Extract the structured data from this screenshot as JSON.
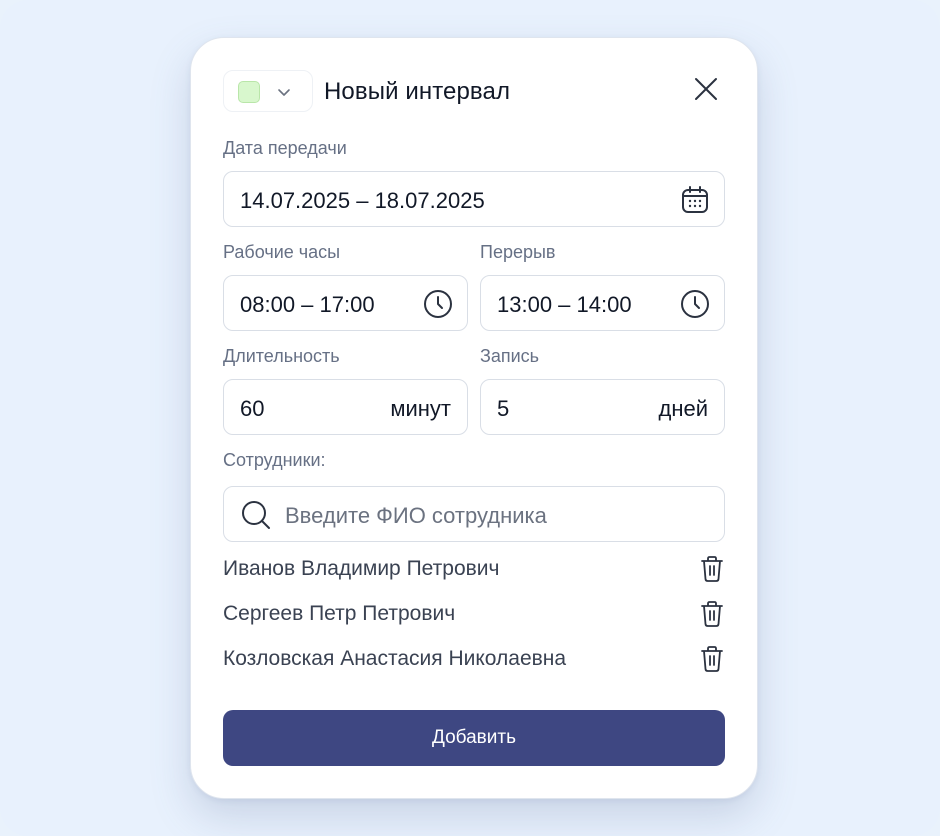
{
  "modal": {
    "title": "Новый интервал",
    "color_swatch": "#d8f7cd",
    "accent": "#3e4782"
  },
  "date": {
    "label": "Дата передачи",
    "value": "14.07.2025 – 18.07.2025",
    "icon": "calendar-icon"
  },
  "work_hours": {
    "label": "Рабочие часы",
    "value": "08:00 – 17:00",
    "icon": "clock-icon"
  },
  "break": {
    "label": "Перерыв",
    "value": "13:00 – 14:00",
    "icon": "clock-icon"
  },
  "duration": {
    "label": "Длительность",
    "value": "60",
    "unit": "минут"
  },
  "booking": {
    "label": "Запись",
    "value": "5",
    "unit": "дней"
  },
  "employees": {
    "label": "Сотрудники:",
    "search_placeholder": "Введите ФИО сотрудника",
    "list": [
      {
        "name": "Иванов Владимир Петрович"
      },
      {
        "name": "Сергеев Петр Петрович"
      },
      {
        "name": "Козловская Анастасия Николаевна"
      }
    ]
  },
  "submit": {
    "label": "Добавить"
  }
}
